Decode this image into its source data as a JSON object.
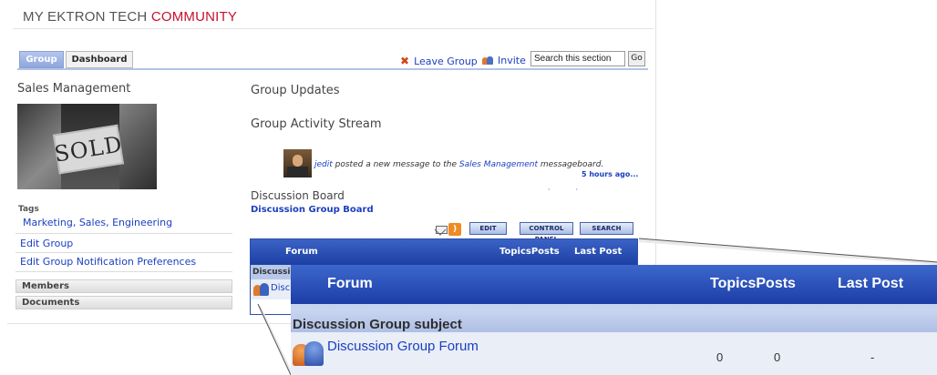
{
  "brand": {
    "prefix": "MY EKTRON TECH ",
    "accent": "COMMUNITY"
  },
  "tabs": {
    "group": "Group",
    "dashboard": "Dashboard"
  },
  "actions": {
    "leave_group": "Leave Group",
    "invite": "Invite",
    "search_value": "Search this section",
    "go": "Go"
  },
  "sidebar": {
    "group_name": "Sales Management",
    "image_text": "SOLD",
    "tags_label": "Tags",
    "tags": "Marketing, Sales, Engineering",
    "edit_group": "Edit Group",
    "edit_notifications": "Edit Group Notification Preferences",
    "members": "Members",
    "documents": "Documents"
  },
  "main": {
    "group_updates": "Group Updates",
    "activity_stream": "Group Activity Stream",
    "activity": {
      "user": "jedit",
      "text_before": " posted a new message to the ",
      "board": "Sales Management",
      "text_after": " messageboard.",
      "time": "5 hours ago..."
    },
    "discussion_board": "Discussion Board",
    "discussion_group_board": "Discussion Group Board"
  },
  "toolbar": {
    "edit": "EDIT",
    "control_panel": "CONTROL PANEL",
    "search": "SEARCH",
    "rss": "☰"
  },
  "forum_small": {
    "col_forum": "Forum",
    "col_topicsposts": "TopicsPosts",
    "col_last_post": "Last Post",
    "subject_truncated": "Discussio",
    "row_truncated": "Disc"
  },
  "forum_zoom": {
    "col_forum": "Forum",
    "col_topicsposts": "TopicsPosts",
    "col_last_post": "Last Post",
    "subject": "Discussion Group subject",
    "row_name": "Discussion Group Forum",
    "topics": "0",
    "posts": "0",
    "last_post": "-"
  },
  "colors": {
    "accent_red": "#c8102e",
    "link_blue": "#1b3fbf",
    "header_blue": "#1d3fa3"
  }
}
